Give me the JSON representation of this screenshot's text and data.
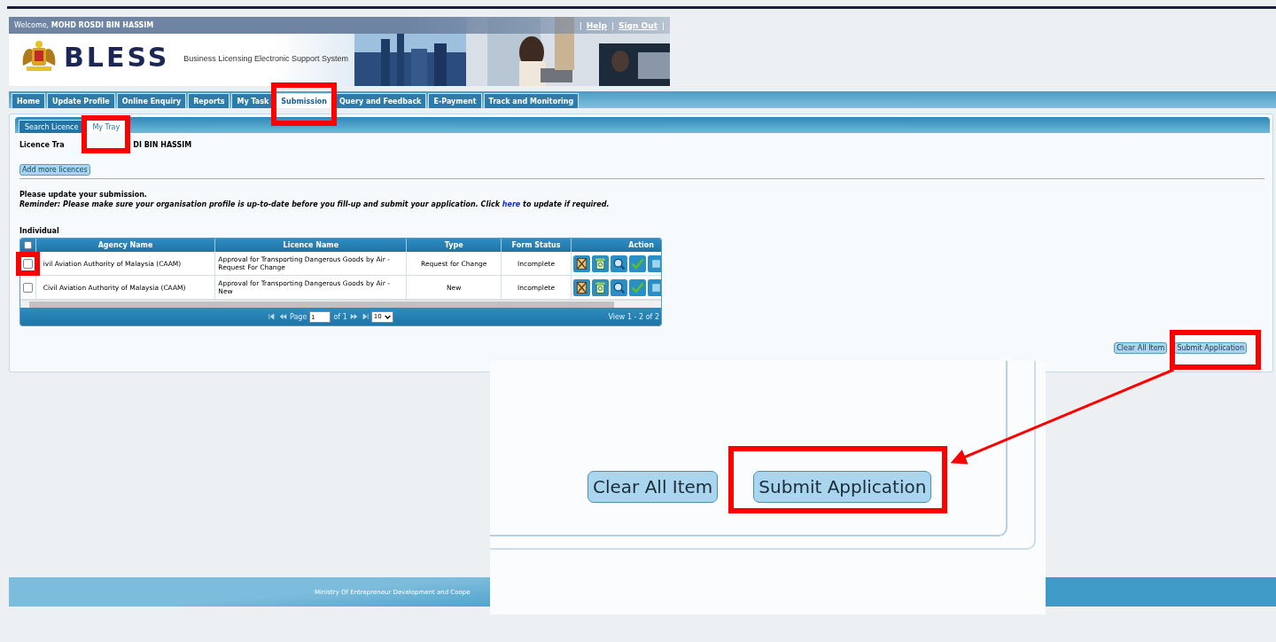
{
  "header": {
    "welcome_label": "Welcome,",
    "user_name": "MOHD ROSDI BIN HASSIM",
    "separator": "|",
    "links": [
      "Help",
      "Sign Out"
    ],
    "logo_text": "BLESS",
    "subtitle": "Business Licensing Electronic Support System"
  },
  "nav_tabs": [
    {
      "label": "Home",
      "selected": false
    },
    {
      "label": "Update Profile",
      "selected": false
    },
    {
      "label": "Online Enquiry",
      "selected": false
    },
    {
      "label": "Reports",
      "selected": false
    },
    {
      "label": "My Task",
      "selected": false
    },
    {
      "label": "Submission",
      "selected": true
    },
    {
      "label": "Query and Feedback",
      "selected": false
    },
    {
      "label": "E-Payment",
      "selected": false
    },
    {
      "label": "Track and Monitoring",
      "selected": false
    }
  ],
  "sub_tabs": [
    {
      "label": "Search Licence",
      "selected": false
    },
    {
      "label": "My Tray",
      "selected": true
    }
  ],
  "tray": {
    "title_start": "Licence Tra",
    "title_end": "DI BIN HASSIM",
    "add_button": "Add more licences",
    "notice": "Please update your submission.",
    "reminder": "Reminder: Please make sure your organisation profile is up-to-date before you fill-up and submit your application. Click",
    "reminder_link": "here",
    "reminder_end": "to update if required.",
    "section_label": "Individual"
  },
  "table": {
    "header_checked": false,
    "columns": [
      "Agency Name",
      "Licence Name",
      "Type",
      "Form Status",
      "Action"
    ],
    "rows": [
      {
        "checked": false,
        "agency": "ivil Aviation Authority of Malaysia (CAAM)",
        "licence": "Approval for Transporting Dangerous Goods by Air - Request For Change",
        "type": "Request for Change",
        "status": "Incomplete"
      },
      {
        "checked": false,
        "agency": "Civil Aviation Authority of Malaysia (CAAM)",
        "licence": "Approval for Transporting Dangerous Goods by Air - New",
        "type": "New",
        "status": "Incomplete"
      }
    ]
  },
  "pager": {
    "page_label": "Page",
    "page": "1",
    "of": "of 1",
    "page_size": "10",
    "summary": "View 1 - 2 of 2"
  },
  "actions": [
    "Clear All Item",
    "Submit Application"
  ],
  "footer": "Ministry Of Entrepreneur Development and Coope",
  "zoom_inset": {
    "buttons": [
      "Clear All Item",
      "Submit Application"
    ]
  }
}
